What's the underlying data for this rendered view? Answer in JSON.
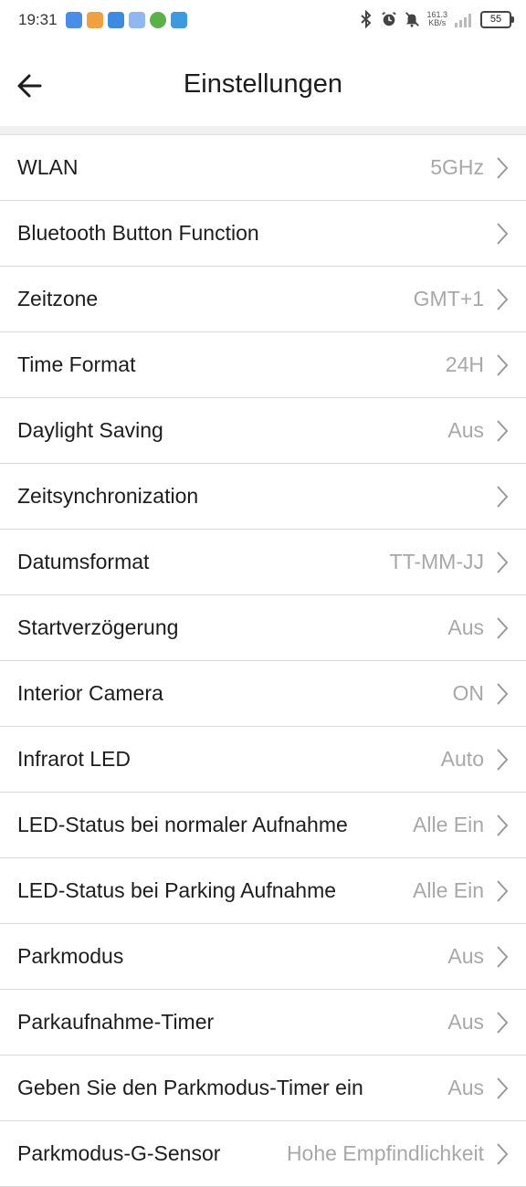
{
  "status_bar": {
    "time": "19:31",
    "network_speed": "161.3",
    "network_speed_unit": "KB/s",
    "battery": "55"
  },
  "header": {
    "title": "Einstellungen"
  },
  "settings": [
    {
      "label": "WLAN",
      "value": "5GHz"
    },
    {
      "label": "Bluetooth Button Function",
      "value": ""
    },
    {
      "label": "Zeitzone",
      "value": "GMT+1"
    },
    {
      "label": "Time Format",
      "value": "24H"
    },
    {
      "label": "Daylight Saving",
      "value": "Aus"
    },
    {
      "label": "Zeitsynchronization",
      "value": ""
    },
    {
      "label": "Datumsformat",
      "value": "TT-MM-JJ"
    },
    {
      "label": "Startverzögerung",
      "value": "Aus"
    },
    {
      "label": "Interior Camera",
      "value": "ON"
    },
    {
      "label": "Infrarot LED",
      "value": "Auto"
    },
    {
      "label": "LED-Status bei normaler Aufnahme",
      "value": "Alle Ein"
    },
    {
      "label": "LED-Status bei Parking Aufnahme",
      "value": "Alle Ein"
    },
    {
      "label": "Parkmodus",
      "value": "Aus"
    },
    {
      "label": "Parkaufnahme-Timer",
      "value": "Aus"
    },
    {
      "label": "Geben Sie den Parkmodus-Timer ein",
      "value": "Aus"
    },
    {
      "label": "Parkmodus-G-Sensor",
      "value": "Hohe Empfindlichkeit"
    }
  ]
}
